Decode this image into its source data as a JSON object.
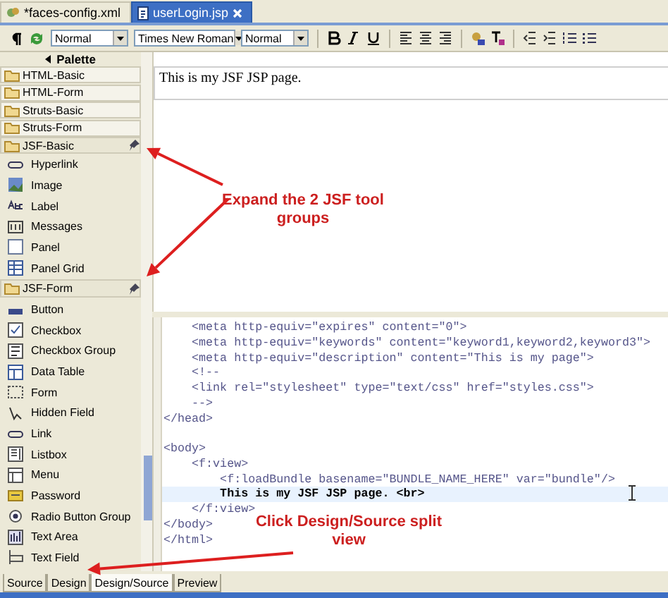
{
  "editor_tabs": [
    {
      "label": "*faces-config.xml",
      "selected": false
    },
    {
      "label": "userLogin.jsp",
      "selected": true
    }
  ],
  "toolbar": {
    "paragraph_style": "Normal",
    "font": "Times New Roman",
    "font_size": "Normal"
  },
  "palette": {
    "title": "Palette",
    "groups": [
      {
        "label": "HTML-Basic",
        "expanded": false
      },
      {
        "label": "HTML-Form",
        "expanded": false
      },
      {
        "label": "Struts-Basic",
        "expanded": false
      },
      {
        "label": "Struts-Form",
        "expanded": false
      },
      {
        "label": "JSF-Basic",
        "expanded": true,
        "children": [
          {
            "label": "Hyperlink"
          },
          {
            "label": "Image"
          },
          {
            "label": "Label"
          },
          {
            "label": "Messages"
          },
          {
            "label": "Panel"
          },
          {
            "label": "Panel Grid"
          }
        ]
      },
      {
        "label": "JSF-Form",
        "expanded": true,
        "children": [
          {
            "label": "Button"
          },
          {
            "label": "Checkbox"
          },
          {
            "label": "Checkbox Group"
          },
          {
            "label": "Data Table"
          },
          {
            "label": "Form"
          },
          {
            "label": "Hidden Field"
          },
          {
            "label": "Link"
          },
          {
            "label": "Listbox"
          },
          {
            "label": "Menu"
          },
          {
            "label": "Password"
          },
          {
            "label": "Radio Button Group"
          },
          {
            "label": "Text Area"
          },
          {
            "label": "Text Field"
          }
        ]
      }
    ]
  },
  "design_view": {
    "text": "This is my JSF JSP page."
  },
  "source_lines": [
    {
      "text": "    <meta http-equiv=\"expires\" content=\"0\">",
      "current": false
    },
    {
      "text": "    <meta http-equiv=\"keywords\" content=\"keyword1,keyword2,keyword3\">",
      "current": false
    },
    {
      "text": "    <meta http-equiv=\"description\" content=\"This is my page\">",
      "current": false
    },
    {
      "text": "    <!--",
      "current": false
    },
    {
      "text": "    <link rel=\"stylesheet\" type=\"text/css\" href=\"styles.css\">",
      "current": false
    },
    {
      "text": "    -->",
      "current": false
    },
    {
      "text": "</head>",
      "current": false
    },
    {
      "current": false
    },
    {
      "text": "<body>",
      "current": false
    },
    {
      "text": "    <f:view>",
      "current": false
    },
    {
      "text": "        <f:loadBundle basename=\"BUNDLE_NAME_HERE\" var=\"bundle\"/>",
      "current": false
    },
    {
      "text": "        This is my JSF JSP page. <br>",
      "current": true
    },
    {
      "text": "    </f:view>",
      "current": false
    },
    {
      "text": "</body>",
      "current": false
    },
    {
      "text": "</html>",
      "current": false
    }
  ],
  "annotations": [
    {
      "text": "Expand the 2 JSF tool groups"
    },
    {
      "text": "Click Design/Source split view"
    }
  ],
  "bottom_tabs": [
    {
      "label": "Source",
      "selected": false
    },
    {
      "label": "Design",
      "selected": false
    },
    {
      "label": "Design/Source",
      "selected": true
    },
    {
      "label": "Preview",
      "selected": false
    }
  ]
}
